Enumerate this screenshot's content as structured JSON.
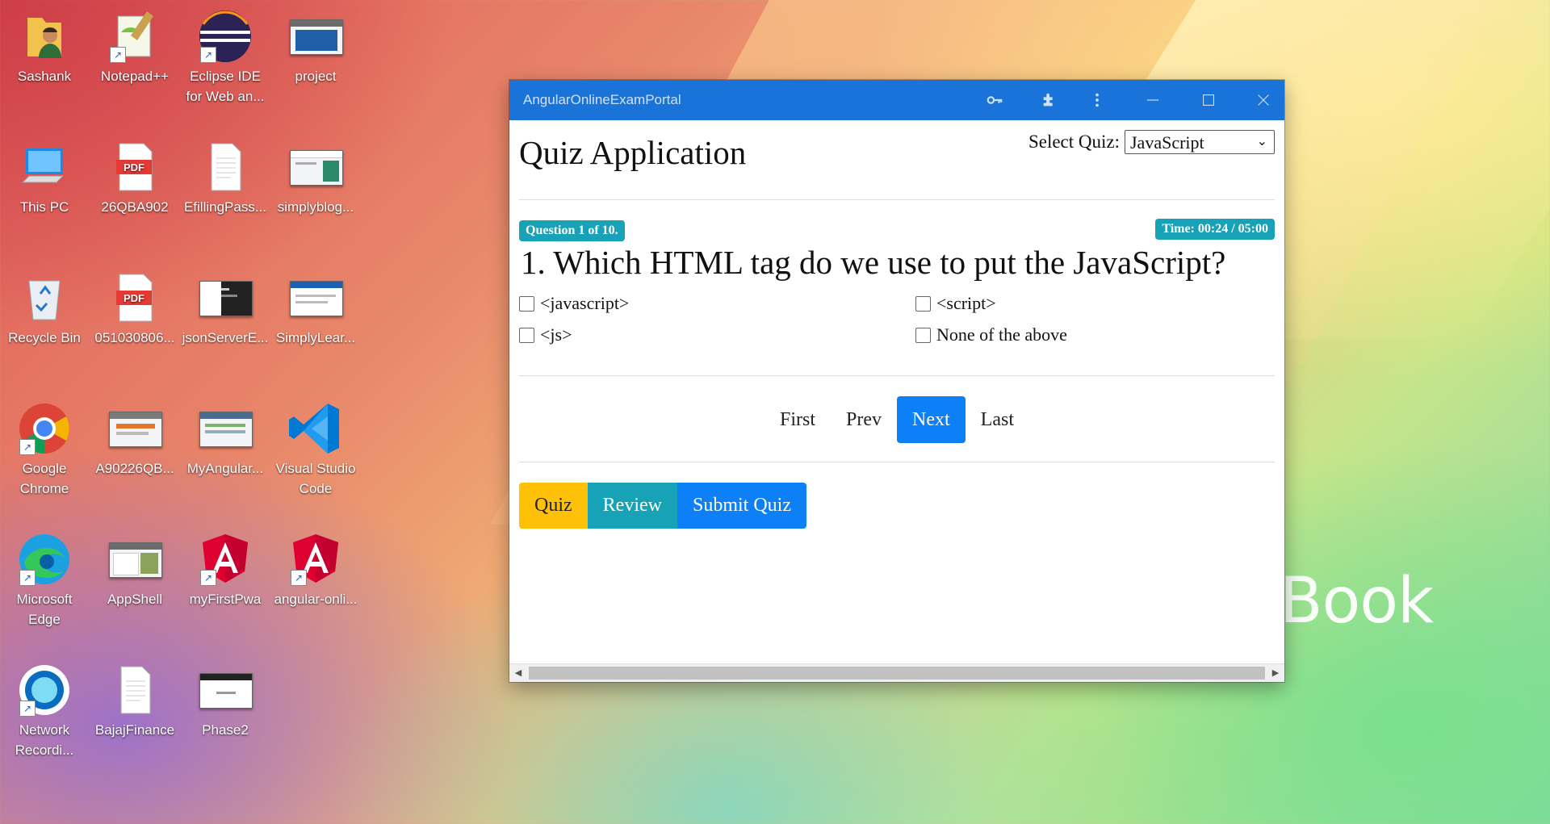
{
  "desktop": {
    "background_text": "Book",
    "icons": [
      {
        "label": "Sashank",
        "icon": "user-folder-icon"
      },
      {
        "label": "Notepad++",
        "icon": "notepad-plus-icon"
      },
      {
        "label": "Eclipse IDE for Web an...",
        "icon": "eclipse-icon"
      },
      {
        "label": "project",
        "icon": "project-thumbnail-icon"
      },
      {
        "label": "This PC",
        "icon": "computer-icon"
      },
      {
        "label": "26QBA902",
        "icon": "pdf-icon"
      },
      {
        "label": "EfillingPass...",
        "icon": "document-icon"
      },
      {
        "label": "simplyblog...",
        "icon": "thumbnail-icon"
      },
      {
        "label": "Recycle Bin",
        "icon": "recycle-bin-icon"
      },
      {
        "label": "051030806...",
        "icon": "pdf-icon"
      },
      {
        "label": "jsonServerE...",
        "icon": "thumbnail-icon"
      },
      {
        "label": "SimplyLear...",
        "icon": "thumbnail-icon"
      },
      {
        "label": "Google Chrome",
        "icon": "chrome-icon"
      },
      {
        "label": "A90226QB...",
        "icon": "thumbnail-icon"
      },
      {
        "label": "MyAngular...",
        "icon": "thumbnail-icon"
      },
      {
        "label": "Visual Studio Code",
        "icon": "vscode-icon"
      },
      {
        "label": "Microsoft Edge",
        "icon": "edge-icon"
      },
      {
        "label": "AppShell",
        "icon": "thumbnail-icon"
      },
      {
        "label": "myFirstPwa",
        "icon": "angular-icon"
      },
      {
        "label": "angular-onli...",
        "icon": "angular-icon"
      },
      {
        "label": "Network Recordi...",
        "icon": "network-recorder-icon"
      },
      {
        "label": "BajajFinance",
        "icon": "document-icon"
      },
      {
        "label": "Phase2",
        "icon": "thumbnail-icon"
      }
    ]
  },
  "window": {
    "title": "AngularOnlineExamPortal",
    "title_icons": [
      "key-icon",
      "extension-icon",
      "more-vert-icon",
      "minimize-icon",
      "maximize-icon",
      "close-icon"
    ]
  },
  "app": {
    "title": "Quiz Application",
    "select_label": "Select Quiz:",
    "selected_quiz": "JavaScript",
    "question_badge": "Question 1 of 10.",
    "timer": "Time: 00:24 / 05:00",
    "question": "1. Which HTML tag do we use to put the JavaScript?",
    "options": [
      "<javascript>",
      "<script>",
      "<js>",
      "None of the above"
    ],
    "pager": [
      "First",
      "Prev",
      "Next",
      "Last"
    ],
    "pager_active": "Next",
    "tabs": [
      "Quiz",
      "Review",
      "Submit Quiz"
    ]
  },
  "colors": {
    "titlebar": "#1a73d9",
    "info": "#17a2b8",
    "primary": "#0d7ff7",
    "warning": "#ffc107"
  }
}
